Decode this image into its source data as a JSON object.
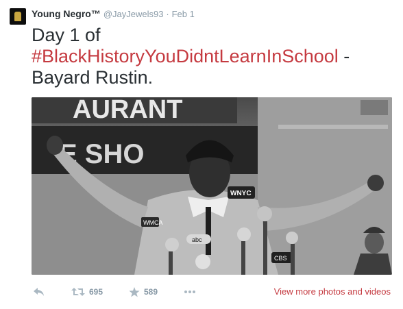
{
  "tweet": {
    "author_name": "Young Negro™",
    "handle": "@JayJewels93",
    "separator": "·",
    "date": "Feb 1",
    "text_before": "Day 1 of",
    "hashtag": "#BlackHistoryYouDidntLearnInSchool",
    "text_dash": " -",
    "text_after": "Bayard Rustin.",
    "media": {
      "storefront_sign_top": "AURANT",
      "storefront_sign_bottom": "E SHO",
      "microphone_labels": [
        "WNYC",
        "abc",
        "WMCA",
        "CBS"
      ]
    },
    "actions": {
      "reply_icon": "reply-arrow-icon",
      "retweet_icon": "retweet-icon",
      "retweet_count": "695",
      "favorite_icon": "star-icon",
      "favorite_count": "589",
      "more_icon": "ellipsis-icon",
      "view_more_label": "View more photos and videos"
    },
    "colors": {
      "hashtag": "#c53a40",
      "muted": "#8899a6",
      "text": "#292f33"
    }
  }
}
